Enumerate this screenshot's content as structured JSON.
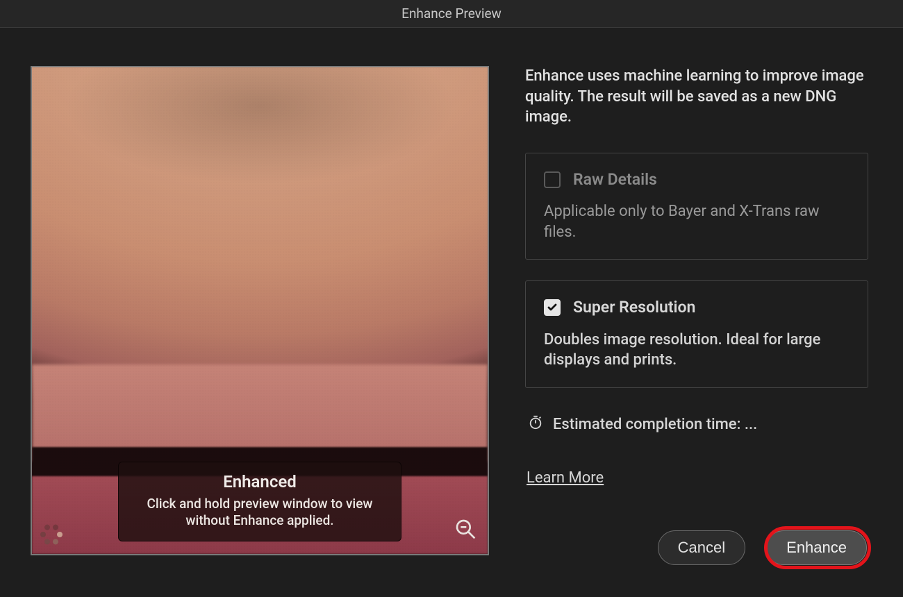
{
  "window": {
    "title": "Enhance Preview"
  },
  "description": "Enhance uses machine learning to improve image quality. The result will be saved as a new DNG image.",
  "options": {
    "raw_details": {
      "label": "Raw Details",
      "desc": "Applicable only to Bayer and X-Trans raw files.",
      "checked": false,
      "enabled": false
    },
    "super_resolution": {
      "label": "Super Resolution",
      "desc": "Doubles image resolution. Ideal for large displays and prints.",
      "checked": true,
      "enabled": true
    }
  },
  "estimate": {
    "label": "Estimated completion time: ..."
  },
  "learn_more": "Learn More",
  "preview_overlay": {
    "title": "Enhanced",
    "sub": "Click and hold preview window to view without Enhance applied."
  },
  "buttons": {
    "cancel": "Cancel",
    "enhance": "Enhance"
  }
}
